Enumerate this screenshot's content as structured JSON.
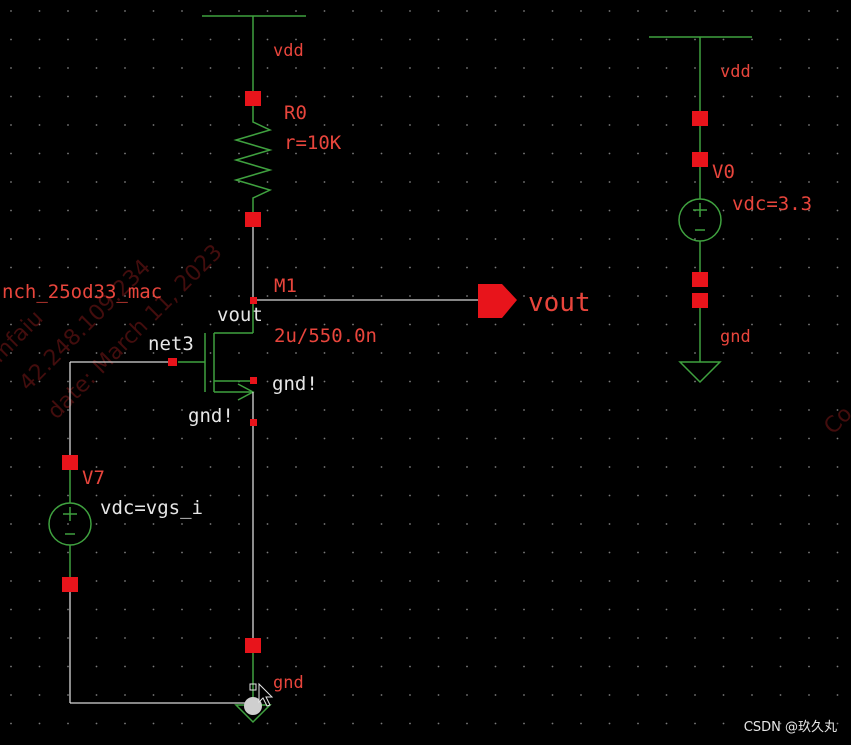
{
  "schematic": {
    "supply_label_main": "vdd",
    "supply_label_right": "vdd",
    "resistor_name": "R0",
    "resistor_value": "r=10K",
    "transistor_model": "nch_25od33_mac",
    "transistor_name": "M1",
    "transistor_size": "2u/550.0n",
    "drain_net": "vout",
    "gate_net": "net3",
    "bulk_net": "gnd!",
    "source_net": "gnd!",
    "output_pin": "vout",
    "vsource_main_name": "V0",
    "vsource_main_value": "vdc=3.3",
    "vsource_gate_name": "V7",
    "vsource_gate_value": "vdc=vgs_i",
    "ground_label_right": "gnd",
    "ground_label_bottom": "gnd"
  },
  "watermark": {
    "line1": "mfaiu",
    "line2": "42.248.109.234",
    "line3": "date: March 11, 2023",
    "right": "Co"
  },
  "credit": "CSDN @玖久丸",
  "colors": {
    "background": "#000000",
    "label_red": "#e8453c",
    "wire": "#d6d6d6",
    "component_green": "#3fa13f",
    "pin_red": "#e8141b"
  }
}
